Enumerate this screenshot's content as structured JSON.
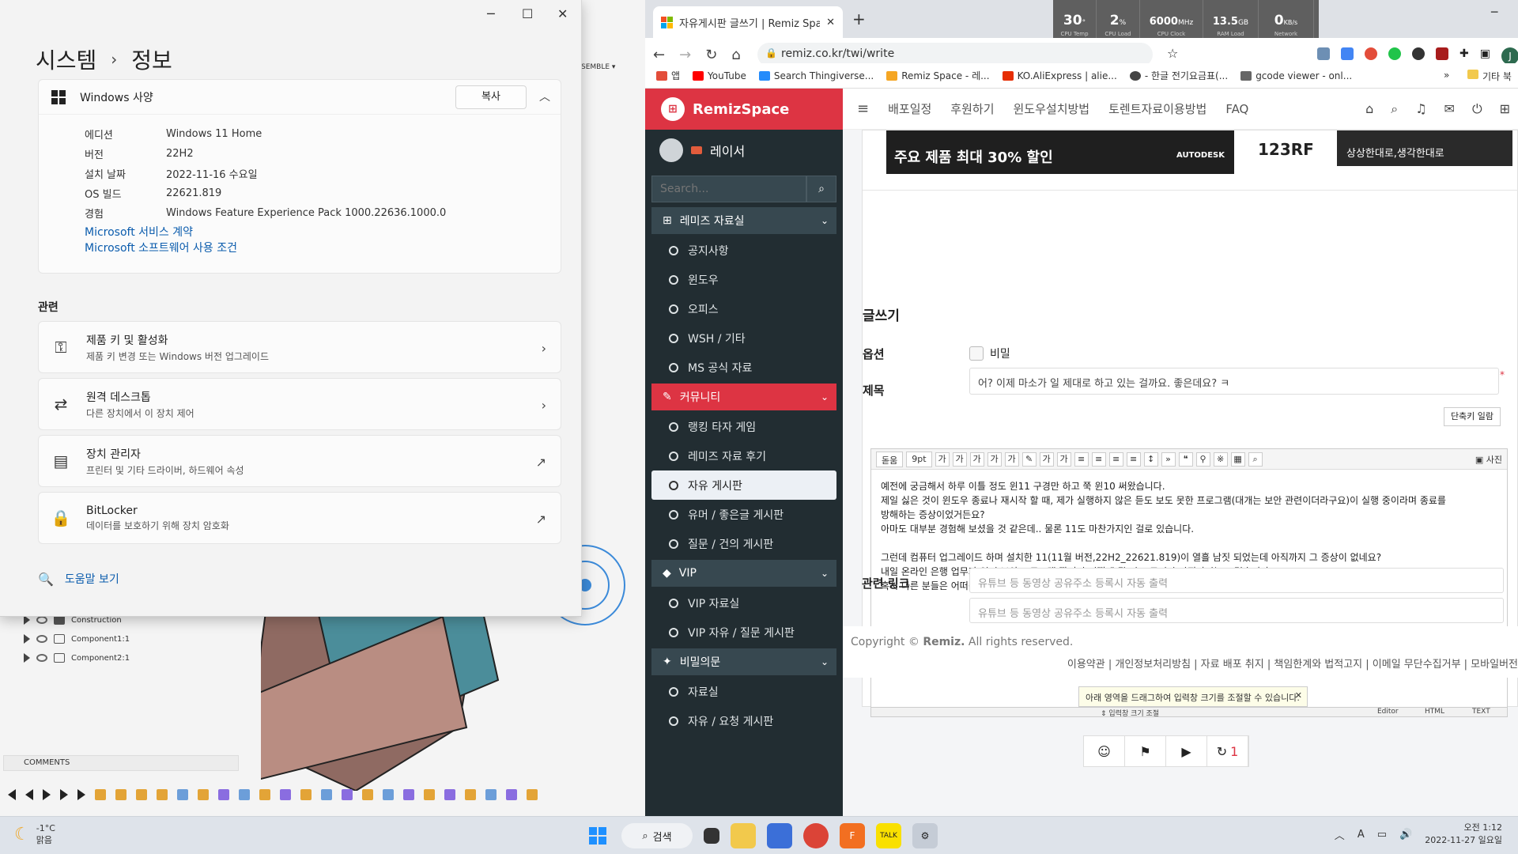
{
  "settings": {
    "breadcrumb_parent": "시스템",
    "breadcrumb_sep": "›",
    "breadcrumb_current": "정보",
    "spec_title": "Windows 사양",
    "copy_label": "복사",
    "specs": [
      {
        "k": "에디션",
        "v": "Windows 11 Home"
      },
      {
        "k": "버전",
        "v": "22H2"
      },
      {
        "k": "설치 날짜",
        "v": "2022-11-16 수요일"
      },
      {
        "k": "OS 빌드",
        "v": "22621.819"
      },
      {
        "k": "경험",
        "v": "Windows Feature Experience Pack 1000.22636.1000.0"
      }
    ],
    "link1": "Microsoft 서비스 계약",
    "link2": "Microsoft 소프트웨어 사용 조건",
    "related_title": "관련",
    "related": [
      {
        "title": "제품 키 및 활성화",
        "sub": "제품 키 변경 또는 Windows 버전 업그레이드",
        "icon": "key-icon",
        "glyph": "⚿",
        "trail": "›"
      },
      {
        "title": "원격 데스크톱",
        "sub": "다른 장치에서 이 장치 제어",
        "icon": "remote-desktop-icon",
        "glyph": "⇄",
        "trail": "›"
      },
      {
        "title": "장치 관리자",
        "sub": "프린터 및 기타 드라이버, 하드웨어 속성",
        "icon": "device-manager-icon",
        "glyph": "▤",
        "trail": "↗"
      },
      {
        "title": "BitLocker",
        "sub": "데이터를 보호하기 위해 장치 암호화",
        "icon": "bitlocker-icon",
        "glyph": "🔒",
        "trail": "↗"
      }
    ],
    "help_label": "도움말 보기"
  },
  "cad": {
    "assemble_label": "SEMBLE ▾",
    "rows": [
      "Construction",
      "Component1:1",
      "Component2:1"
    ],
    "comments_label": "COMMENTS"
  },
  "browser": {
    "tab_title": "자유게시판 글쓰기 | Remiz Spac",
    "url": "remiz.co.kr/twi/write",
    "perf": [
      {
        "v": "30",
        "u": "°",
        "l": "CPU Temp"
      },
      {
        "v": "2",
        "u": "%",
        "l": "CPU Load"
      },
      {
        "v": "6000",
        "u": "MHz",
        "l": "CPU Clock"
      },
      {
        "v": "13.5",
        "u": "GB",
        "l": "RAM Load"
      },
      {
        "v": "0",
        "u": "KB/s",
        "l": "Network"
      }
    ],
    "bookmarks": [
      {
        "label": "앱",
        "color": "#e34d3a"
      },
      {
        "label": "YouTube",
        "color": "#ff0000"
      },
      {
        "label": "Search Thingiverse...",
        "color": "#248bfb"
      },
      {
        "label": "Remiz Space - 레...",
        "color": "#f5a623"
      },
      {
        "label": "KO.AliExpress | alie...",
        "color": "#e62e04"
      },
      {
        "label": "- 한글 전기요금표(...",
        "color": "#444444"
      },
      {
        "label": "gcode viewer - onl...",
        "color": "#666666"
      }
    ],
    "bookmark_more": "»",
    "bookmark_other": "기타 북"
  },
  "site": {
    "brand": "RemizSpace",
    "username": "레이서",
    "search_placeholder": "Search...",
    "menu": [
      {
        "type": "sec",
        "label": "레미즈 자료실",
        "active": false,
        "icon": "windows-icon",
        "glyph": "⊞"
      },
      {
        "type": "item",
        "label": "공지사항"
      },
      {
        "type": "item",
        "label": "윈도우"
      },
      {
        "type": "item",
        "label": "오피스"
      },
      {
        "type": "item",
        "label": "WSH / 기타"
      },
      {
        "type": "item",
        "label": "MS 공식 자료"
      },
      {
        "type": "sec",
        "label": "커뮤니티",
        "active": true,
        "icon": "community-icon",
        "glyph": "✎"
      },
      {
        "type": "item",
        "label": "랭킹 타자 게임"
      },
      {
        "type": "item",
        "label": "레미즈 자료 후기"
      },
      {
        "type": "item",
        "label": "자유 게시판",
        "selected": true
      },
      {
        "type": "item",
        "label": "유머 / 좋은글 게시판"
      },
      {
        "type": "item",
        "label": "질문 / 건의 게시판"
      },
      {
        "type": "sec",
        "label": "VIP",
        "active": false,
        "icon": "diamond-icon",
        "glyph": "◆"
      },
      {
        "type": "item",
        "label": "VIP 자료실"
      },
      {
        "type": "item",
        "label": "VIP 자유 / 질문 게시판"
      },
      {
        "type": "sec",
        "label": "비밀의문",
        "active": false,
        "icon": "magic-wand-icon",
        "glyph": "✦"
      },
      {
        "type": "item",
        "label": "자료실"
      },
      {
        "type": "item",
        "label": "자유 / 요청 게시판"
      }
    ],
    "topnav": [
      "배포일정",
      "후원하기",
      "윈도우설치방법",
      "토렌트자료이용방법",
      "FAQ"
    ],
    "ad_text": "주요 제품 최대 30% 할인",
    "ad_badge": "AUTODESK",
    "ad2_text": "123RF",
    "ad3_text": "상상한대로,생각한대로",
    "form_title": "글쓰기",
    "option_label": "옵션",
    "secret_label": "비밀",
    "subject_label": "제목",
    "subject_value": "어? 이제 마소가 일 제대로 하고 있는 걸까요. 좋은데요? ㅋ",
    "shortcut_label": "단축키 일람",
    "editor_font": "돋움",
    "editor_size": "9pt",
    "editor_photo": "사진",
    "editor_lines": [
      "예전에 궁금해서 하루 이틀 정도 윈11 구경만 하고 쭉 윈10 써왔습니다.",
      "제일 싫은 것이 윈도우 종료나 재시작 할 때, 제가 실행하지 않은 듣도 보도 못한 프로그램(대개는 보안 관련이더라구요)이 실행 중이라며 종료를",
      "방해하는 증상이었거든요?",
      "아마도 대부분 경험해 보셨을 것 같은데.. 물론 11도 마찬가지인 걸로 있습니다.",
      "",
      "그런데 컴퓨터 업그레이드 하며 설치한 11(11월 버전,22H2_22621.819)이 열흘 남짓 되었는데 아직까지 그 증상이 없네요?",
      "내일 온라인 은행 업무가 있어 보안 프로그램 깔리면 어떻게 될 지 모르지만 아직까지는 그렇습니다. ^^",
      "혹시 다른 분들은 어떠신지요?"
    ],
    "resize_tip": "아래 영역을 드래그하여 입력창 크기를 조절할 수 있습니다.",
    "resize_label": "⇕ 입력창 크기 조절",
    "editor_tabs": [
      "Editor",
      "HTML",
      "TEXT"
    ],
    "emoji_count": "1",
    "related_label": "관련 링크",
    "related_placeholder": "유튜브 등 동영상 공유주소 등록시 자동 출력",
    "copyright_prefix": "Copyright © ",
    "copyright_brand": "Remiz.",
    "copyright_suffix": " All rights reserved.",
    "footer_links": "이용약관 | 개인정보처리방침 | 자료 배포 취지 | 책임한계와 법적고지 | 이메일 무단수집거부 | 모바일버전"
  },
  "taskbar": {
    "temp": "-1°C",
    "weather": "맑음",
    "search": "검색",
    "ime": "A",
    "time": "오전 1:12",
    "date": "2022-11-27 일요일"
  }
}
